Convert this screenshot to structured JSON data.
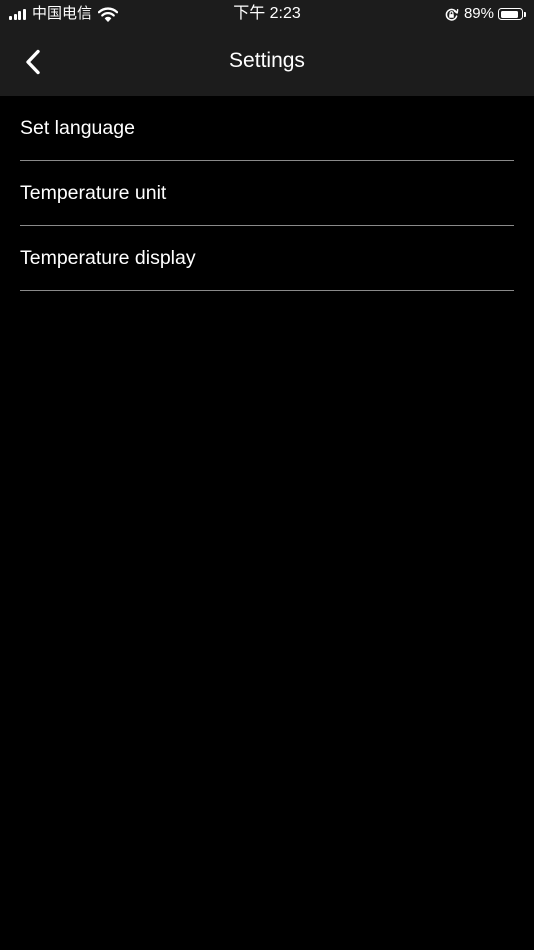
{
  "status_bar": {
    "carrier": "中国电信",
    "time": "下午 2:23",
    "battery_percent": "89%",
    "battery_level": 0.89,
    "icons": [
      "signal-bars-icon",
      "wifi-icon",
      "orientation-lock-icon",
      "battery-icon"
    ]
  },
  "nav": {
    "title": "Settings",
    "back_icon": "chevron-left-icon"
  },
  "settings": {
    "items": [
      {
        "label": "Set language"
      },
      {
        "label": "Temperature unit"
      },
      {
        "label": "Temperature display"
      }
    ]
  },
  "colors": {
    "background": "#000000",
    "bar_background": "#1c1c1c",
    "text": "#ffffff",
    "divider": "#8a8a8a"
  }
}
